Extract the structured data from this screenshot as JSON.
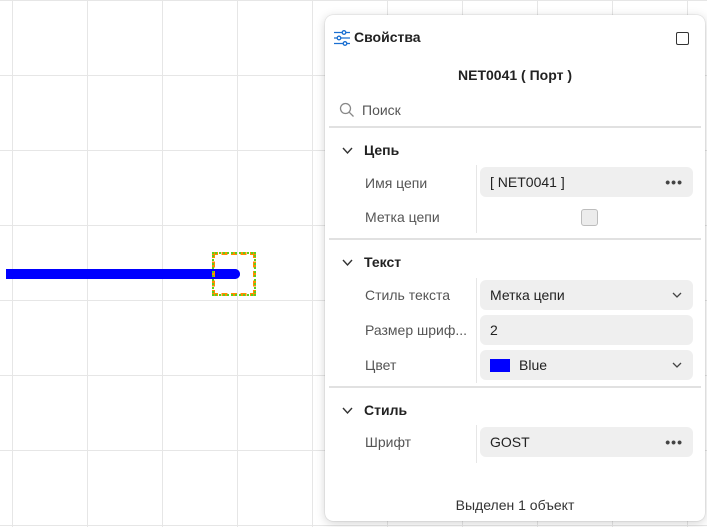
{
  "panel": {
    "title": "Свойства",
    "object_name": "NET0041 ( Порт )",
    "search": {
      "placeholder": "Поиск"
    },
    "sections": {
      "net": {
        "title": "Цепь",
        "net_name": {
          "label": "Имя цепи",
          "value": "[ NET0041 ]"
        },
        "net_label": {
          "label": "Метка цепи",
          "checked": false
        }
      },
      "text": {
        "title": "Текст",
        "text_style": {
          "label": "Стиль текста",
          "value": "Метка цепи"
        },
        "font_size": {
          "label": "Размер шриф...",
          "value": "2"
        },
        "color": {
          "label": "Цвет",
          "value": "Blue",
          "swatch": "#0000ff"
        }
      },
      "style": {
        "title": "Стиль",
        "font": {
          "label": "Шрифт",
          "value": "GOST"
        }
      }
    },
    "more_label": "•••",
    "footer": "Выделен 1 объект"
  },
  "canvas": {
    "wire_color": "#0000ff",
    "selection_colors": [
      "#ff8c00",
      "#5ad11f"
    ]
  },
  "icons": {
    "header": "sliders-icon",
    "maximize": "maximize-icon",
    "search": "search-icon",
    "collapse": "chevron-down-icon"
  }
}
